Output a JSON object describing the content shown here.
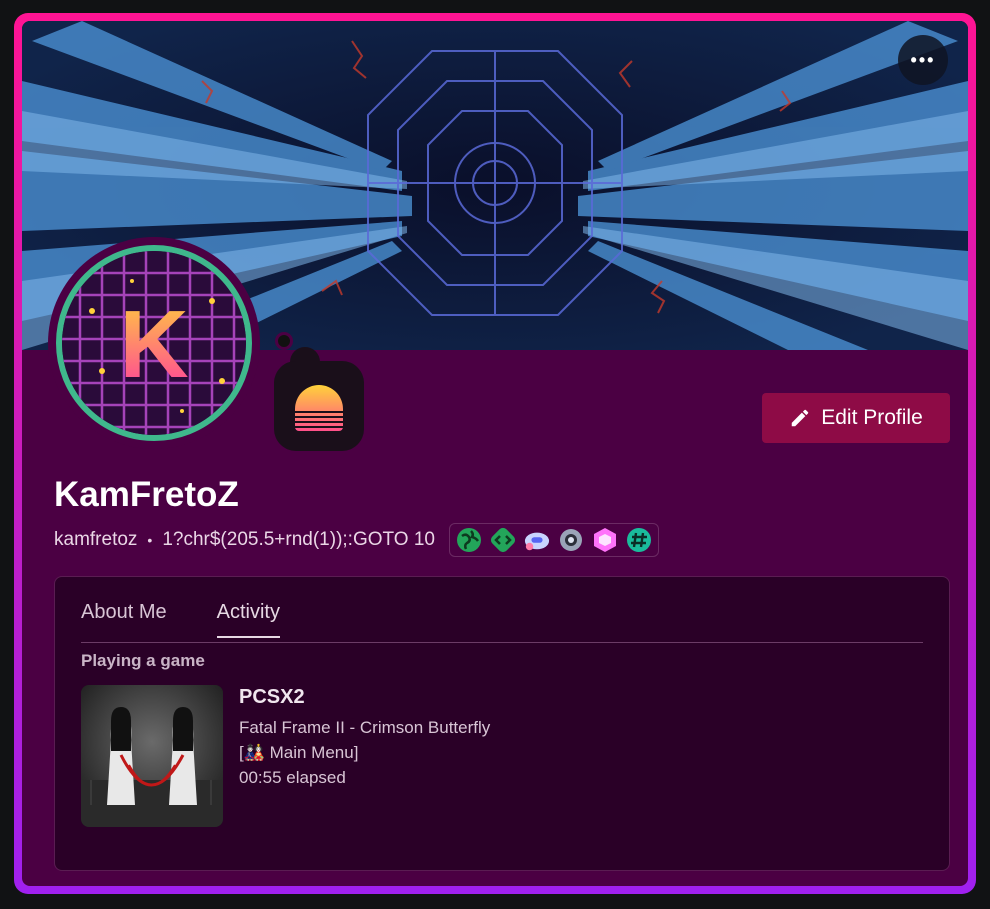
{
  "profile": {
    "display_name": "KamFretoZ",
    "username": "kamfretoz",
    "separator": "•",
    "custom_status": "1?chr$(205.5+rnd(1));:GOTO 10",
    "avatar_letter": "K",
    "edit_label": "Edit Profile",
    "more_label": "•••"
  },
  "tabs": [
    {
      "label": "About Me"
    },
    {
      "label": "Activity"
    }
  ],
  "activity": {
    "section_label": "Playing a game",
    "game": {
      "name": "PCSX2",
      "details": "Fatal Frame II - Crimson Butterfly",
      "state": "[🎎 Main Menu]",
      "elapsed": "00:55 elapsed"
    }
  },
  "badges": [
    "globe-badge",
    "dev-badge",
    "quest-badge",
    "orb-badge",
    "nitro-badge",
    "hashtag-badge"
  ],
  "colors": {
    "border_top": "#ff1493",
    "border_bottom": "#a020f0",
    "card_bg": "#4b0043",
    "panel_bg": "#2a0027",
    "edit_button": "#8e0b46",
    "avatar_ring": "#3fb88c"
  }
}
